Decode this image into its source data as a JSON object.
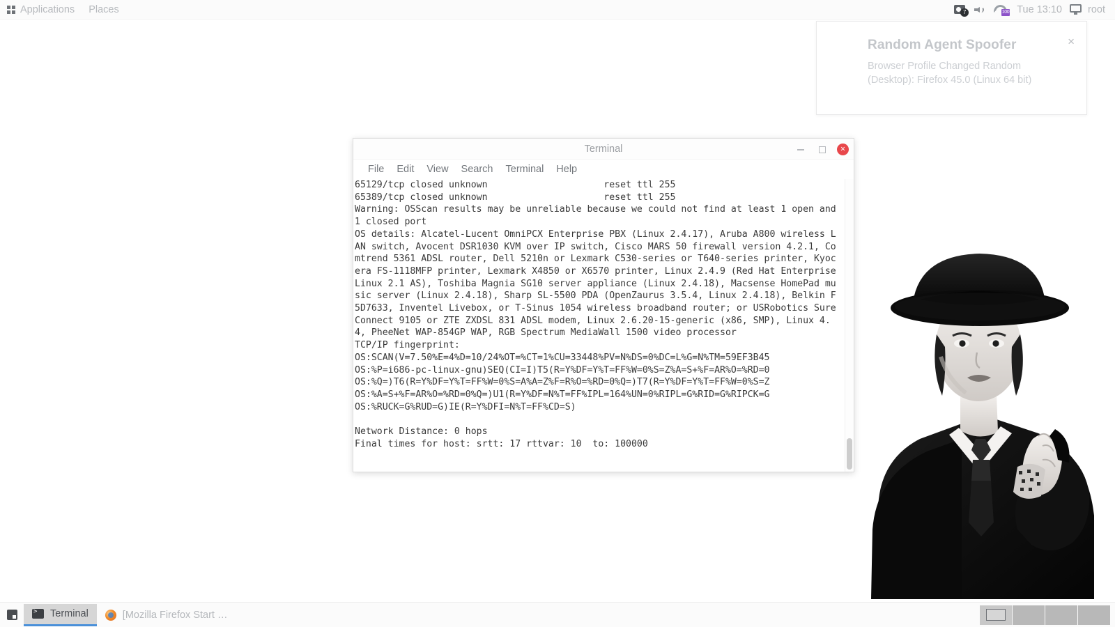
{
  "top_panel": {
    "applications_label": "Applications",
    "places_label": "Places",
    "apps_icon": "grid-icon",
    "tray": {
      "screenshot_icon": "camera-icon",
      "screenshot_badge": "7",
      "speaker_icon": "speaker-icon",
      "network_icon": "wifi-icon",
      "network_badge": "100",
      "clock": "Tue 13:10",
      "monitor_icon": "monitor-icon",
      "user": "root"
    }
  },
  "notification": {
    "title": "Random Agent Spoofer",
    "body": "Browser Profile Changed\nRandom (Desktop): Firefox 45.0 (Linux 64 bit)",
    "close_label": "×"
  },
  "terminal": {
    "title": "Terminal",
    "menu": [
      "File",
      "Edit",
      "View",
      "Search",
      "Terminal",
      "Help"
    ],
    "window_controls": {
      "minimize": "minimize-button",
      "maximize": "maximize-button",
      "close": "×"
    },
    "output": "65129/tcp closed unknown                     reset ttl 255\n65389/tcp closed unknown                     reset ttl 255\nWarning: OSScan results may be unreliable because we could not find at least 1 open and 1 closed port\nOS details: Alcatel-Lucent OmniPCX Enterprise PBX (Linux 2.4.17), Aruba A800 wireless LAN switch, Avocent DSR1030 KVM over IP switch, Cisco MARS 50 firewall version 4.2.1, Comtrend 5361 ADSL router, Dell 5210n or Lexmark C530-series or T640-series printer, Kyocera FS-1118MFP printer, Lexmark X4850 or X6570 printer, Linux 2.4.9 (Red Hat Enterprise Linux 2.1 AS), Toshiba Magnia SG10 server appliance (Linux 2.4.18), Macsense HomePad music server (Linux 2.4.18), Sharp SL-5500 PDA (OpenZaurus 3.5.4, Linux 2.4.18), Belkin F5D7633, Inventel Livebox, or T-Sinus 1054 wireless broadband router; or USRobotics SureConnect 9105 or ZTE ZXDSL 831 ADSL modem, Linux 2.6.20-15-generic (x86, SMP), Linux 4.4, PheeNet WAP-854GP WAP, RGB Spectrum MediaWall 1500 video processor\nTCP/IP fingerprint:\nOS:SCAN(V=7.50%E=4%D=10/24%OT=%CT=1%CU=33448%PV=N%DS=0%DC=L%G=N%TM=59EF3B45\nOS:%P=i686-pc-linux-gnu)SEQ(CI=I)T5(R=Y%DF=Y%T=FF%W=0%S=Z%A=S+%F=AR%O=%RD=0\nOS:%Q=)T6(R=Y%DF=Y%T=FF%W=0%S=A%A=Z%F=R%O=%RD=0%Q=)T7(R=Y%DF=Y%T=FF%W=0%S=Z\nOS:%A=S+%F=AR%O=%RD=0%Q=)U1(R=Y%DF=N%T=FF%IPL=164%UN=0%RIPL=G%RID=G%RIPCK=G\nOS:%RUCK=G%RUD=G)IE(R=Y%DFI=N%T=FF%CD=S)\n\nNetwork Distance: 0 hops\nFinal times for host: srtt: 17 rttvar: 10  to: 100000"
  },
  "taskbar": {
    "show_desktop_icon": "show-desktop-icon",
    "tasks": [
      {
        "label": "Terminal",
        "icon": "terminal-icon",
        "active": true
      },
      {
        "label": "[Mozilla Firefox Start …",
        "icon": "firefox-icon",
        "active": false
      }
    ],
    "workspaces": [
      {
        "name": "workspace-1",
        "active": true
      },
      {
        "name": "workspace-2",
        "active": false
      },
      {
        "name": "workspace-3",
        "active": false
      },
      {
        "name": "workspace-4",
        "active": false
      }
    ]
  },
  "colors": {
    "accent": "#4a90d9",
    "close_red": "#e8474b",
    "badge_purple": "#8c52c9",
    "panel_bg": "#fbfbfb"
  }
}
